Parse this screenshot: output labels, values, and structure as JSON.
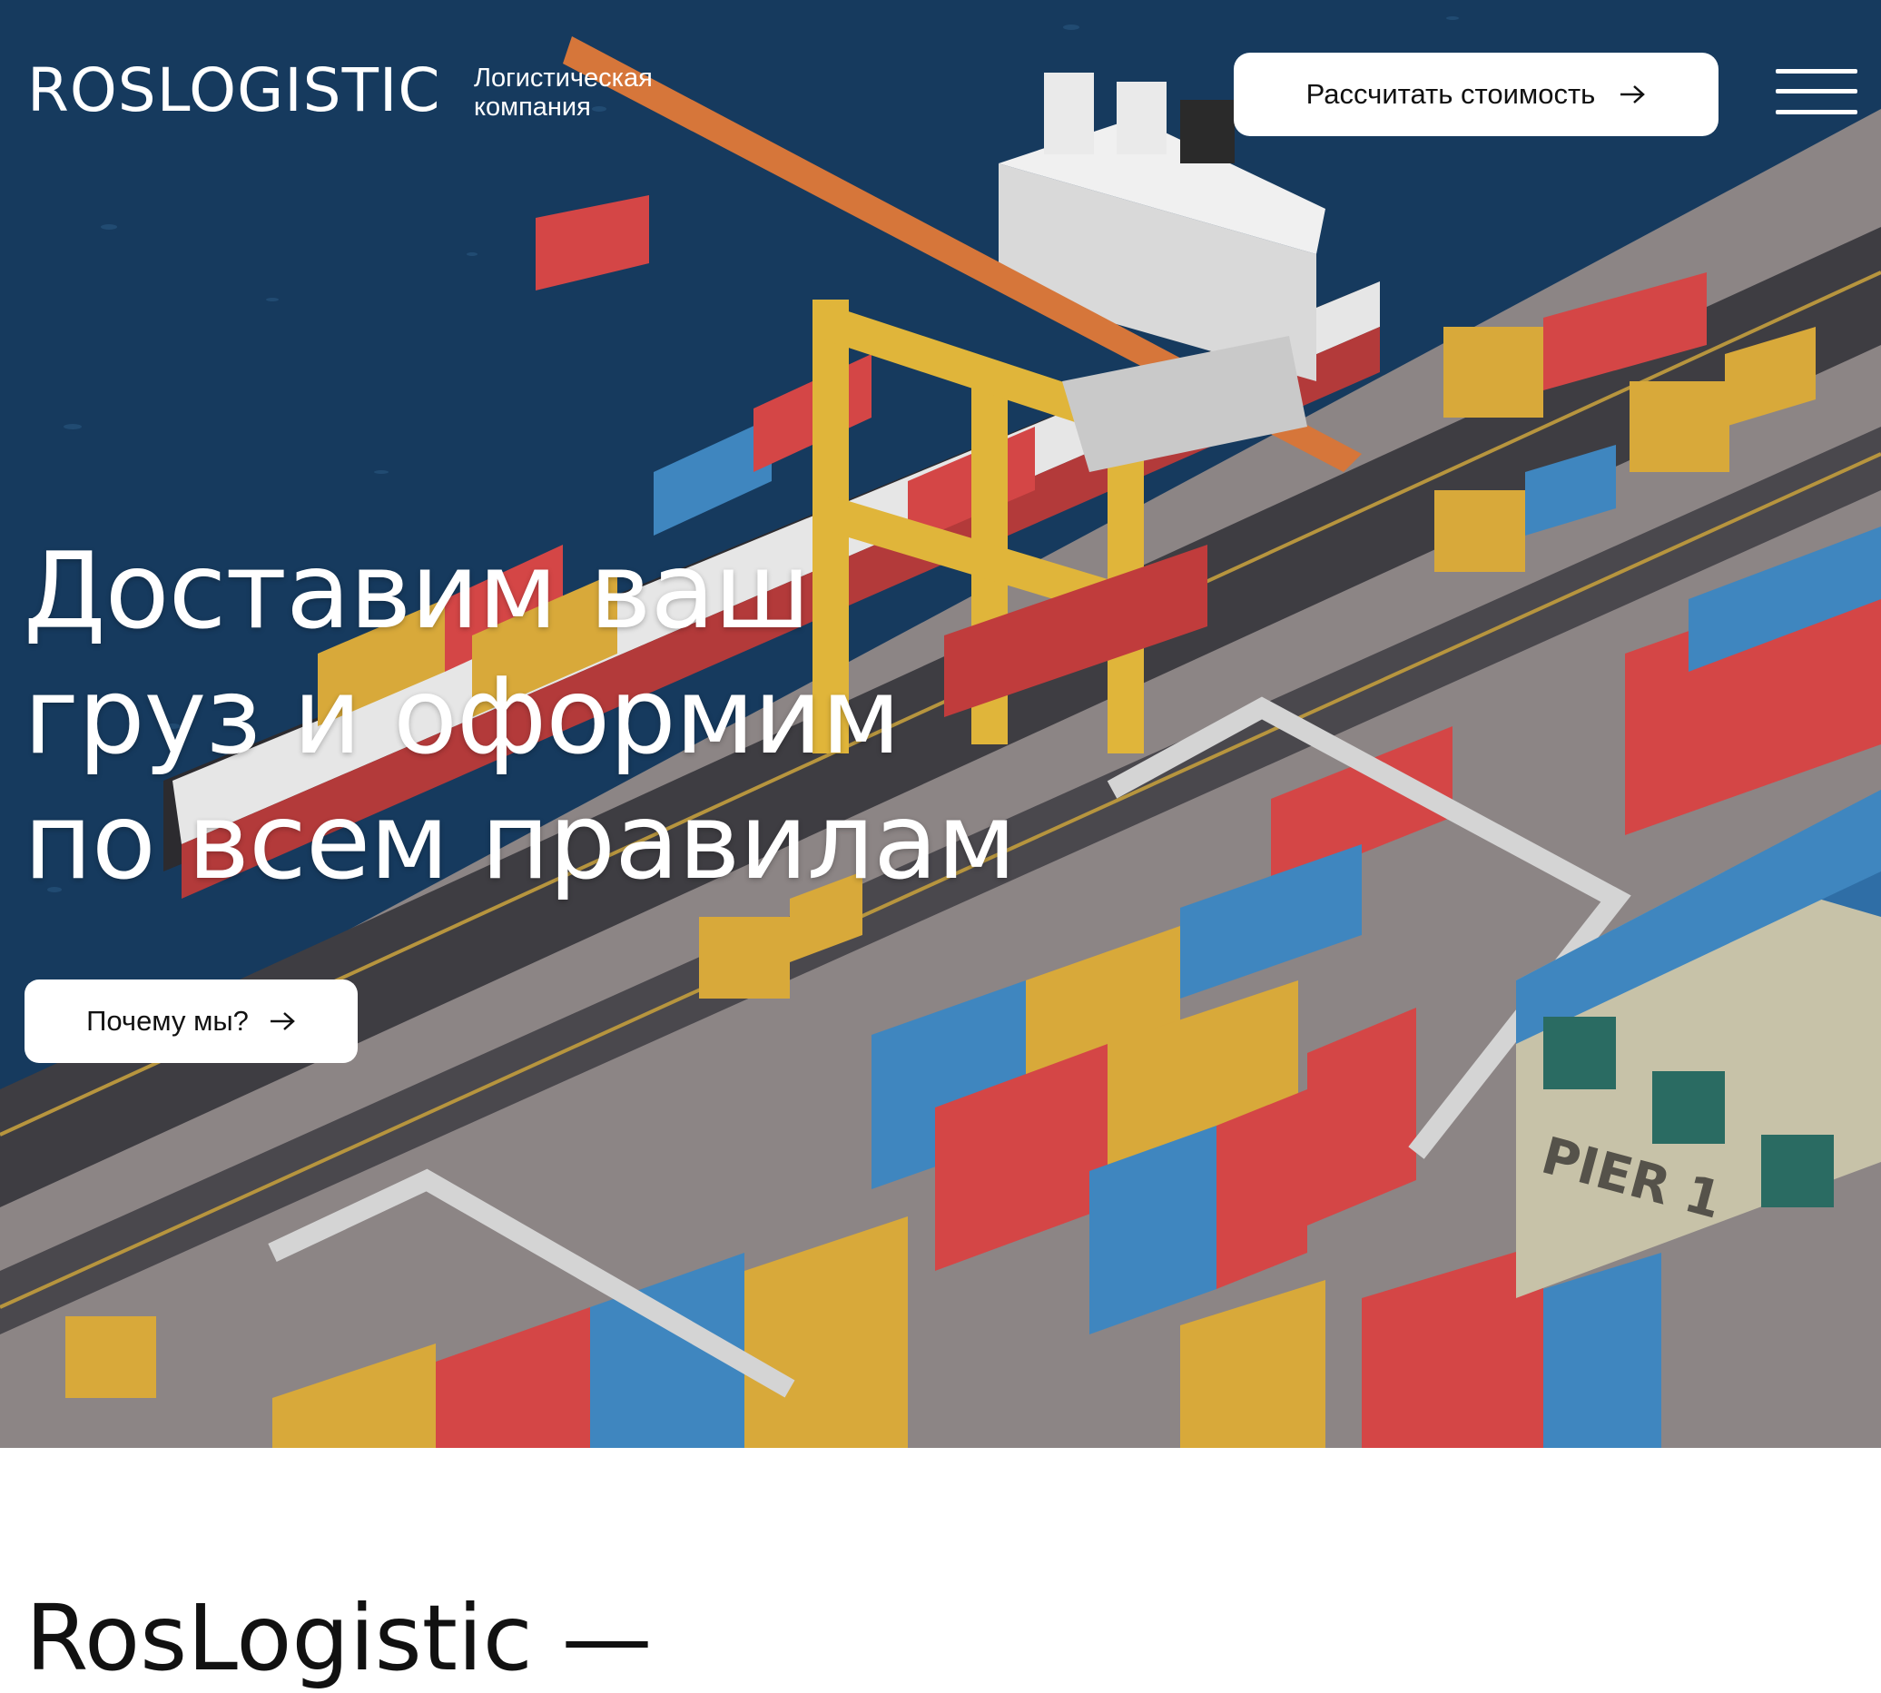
{
  "header": {
    "logo": "ROSLOGISTIC",
    "tagline_line1": "Логистическая",
    "tagline_line2": "компания",
    "cta_label": "Рассчитать стоимость",
    "menu_icon": "hamburger-menu-icon"
  },
  "hero": {
    "headline_line1": "Доставим ваш",
    "headline_line2": "груз и оформим",
    "headline_line3": "по всем правилам",
    "why_button_label": "Почему мы?",
    "pier_sign": "PIER 1"
  },
  "about": {
    "title": "RosLogistic —"
  },
  "colors": {
    "sea": "#163a5e",
    "button_bg": "#ffffff",
    "container_red": "#d44646",
    "container_blue": "#3f86bf",
    "container_yellow": "#d8a93a",
    "crane_yellow": "#e0b53a",
    "pier_ground": "#8c8585"
  }
}
